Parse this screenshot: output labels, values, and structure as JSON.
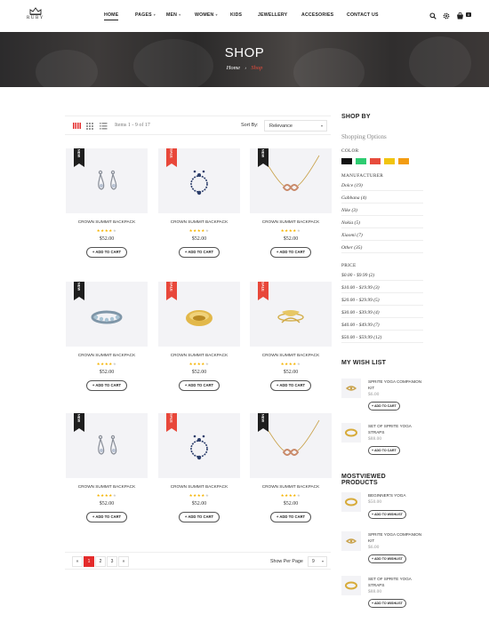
{
  "brand": {
    "name": "RUBY"
  },
  "nav": {
    "items": [
      {
        "label": "HOME",
        "active": true,
        "dropdown": false
      },
      {
        "label": "PAGES",
        "active": false,
        "dropdown": true
      },
      {
        "label": "MEN",
        "active": false,
        "dropdown": true
      },
      {
        "label": "WOMEN",
        "active": false,
        "dropdown": true
      },
      {
        "label": "KIDS",
        "active": false,
        "dropdown": false
      },
      {
        "label": "JEWELLERY",
        "active": false,
        "dropdown": false
      },
      {
        "label": "ACCESORIES",
        "active": false,
        "dropdown": false
      },
      {
        "label": "CONTACT US",
        "active": false,
        "dropdown": false
      }
    ],
    "icons": [
      "search-icon",
      "settings-icon",
      "cart-icon"
    ],
    "cart_count": "0"
  },
  "banner": {
    "title": "SHOP",
    "breadcrumb_home": "Home",
    "breadcrumb_sep": "›",
    "breadcrumb_current": "Shop"
  },
  "toolbar": {
    "view_icons": [
      "grid-4-icon",
      "grid-3-icon",
      "list-icon"
    ],
    "items_count": "Items 1 - 9 of 17",
    "sort_label": "Sort By:",
    "sort_value": "Relevance"
  },
  "products": [
    {
      "badge": "NEW",
      "image": "drop-earrings",
      "name": "CROWN SUMMIT BACKPACK",
      "rating": 4,
      "price": "$52.00",
      "button": "+ ADD TO CART"
    },
    {
      "badge": "SALE",
      "image": "jewel-set",
      "name": "CROWN SUMMIT BACKPACK",
      "rating": 4,
      "price": "$52.00",
      "button": "+ ADD TO CART"
    },
    {
      "badge": "NEW",
      "image": "infinity-necklace",
      "name": "CROWN SUMMIT BACKPACK",
      "rating": 4,
      "price": "$52.00",
      "button": "+ ADD TO CART"
    },
    {
      "badge": "NEW",
      "image": "band-ring",
      "name": "CROWN SUMMIT BACKPACK",
      "rating": 4,
      "price": "$52.00",
      "button": "+ ADD TO CART"
    },
    {
      "badge": "SALE",
      "image": "gold-ring",
      "name": "CROWN SUMMIT BACKPACK",
      "rating": 4,
      "price": "$52.00",
      "button": "+ ADD TO CART"
    },
    {
      "badge": "SALE",
      "image": "bow-ring",
      "name": "CROWN SUMMIT BACKPACK",
      "rating": 4,
      "price": "$52.00",
      "button": "+ ADD TO CART"
    },
    {
      "badge": "NEW",
      "image": "drop-earrings",
      "name": "CROWN SUMMIT BACKPACK",
      "rating": 4,
      "price": "$52.00",
      "button": "+ ADD TO CART"
    },
    {
      "badge": "SALE",
      "image": "jewel-set",
      "name": "CROWN SUMMIT BACKPACK",
      "rating": 4,
      "price": "$52.00",
      "button": "+ ADD TO CART"
    },
    {
      "badge": "NEW",
      "image": "infinity-necklace",
      "name": "CROWN SUMMIT BACKPACK",
      "rating": 4,
      "price": "$52.00",
      "button": "+ ADD TO CART"
    }
  ],
  "pagination": {
    "prev": "«",
    "pages": [
      "1",
      "2",
      "3"
    ],
    "active": "1",
    "next": "»",
    "per_page_label": "Show Per Page",
    "per_page_value": "9"
  },
  "sidebar": {
    "shop_by_title": "SHOP BY",
    "shopping_options": "Shopping Options",
    "color_label": "COLOR",
    "colors": [
      "#111111",
      "#2ecc71",
      "#e74c3c",
      "#f1c40f",
      "#f39c12"
    ],
    "manufacturer_label": "MANUFACTURER",
    "manufacturers": [
      "Dolce (19)",
      "Gabbana (4)",
      "Nike (3)",
      "Nokia (5)",
      "Xiaomi (7)",
      "Other (35)"
    ],
    "price_label": "PRICE",
    "prices": [
      "$0.00 - $9.99 (2)",
      "$10.00 - $19.99 (3)",
      "$20.00 - $29.99 (5)",
      "$30.00 - $39.99 (4)",
      "$40.00 - $49.99 (7)",
      "$50.00 - $59.99 (12)"
    ],
    "wishlist_title": "MY WISH LIST",
    "wishlist": [
      {
        "name": "SPRITE YOGA COMPANION KIT",
        "price": "$6.00",
        "button": "+ ADD TO CART",
        "image": "bow-ring"
      },
      {
        "name": "SET OF SPRITE YOGA STRAPS",
        "price": "$88.00",
        "button": "+ ADD TO CART",
        "image": "gold-ring"
      }
    ],
    "mostviewed_title": "MOSTVIEWED PRODUCTS",
    "mostviewed": [
      {
        "name": "BEGINNER'S YOGA",
        "price": "$50.00",
        "button": "+ ADD TO WISHLIST",
        "image": "gold-ring"
      },
      {
        "name": "SPRITE YOGA COMPANION KIT",
        "price": "$6.00",
        "button": "+ ADD TO WISHLIST",
        "image": "bow-ring"
      },
      {
        "name": "SET OF SPRITE YOGA STRAPS",
        "price": "$88.00",
        "button": "+ ADD TO WISHLIST",
        "image": "gold-ring"
      }
    ]
  },
  "colors": {
    "accent": "#e42c2c",
    "badge_new": "#1e1e1e",
    "badge_sale": "#e8473a",
    "star": "#f5b301"
  }
}
